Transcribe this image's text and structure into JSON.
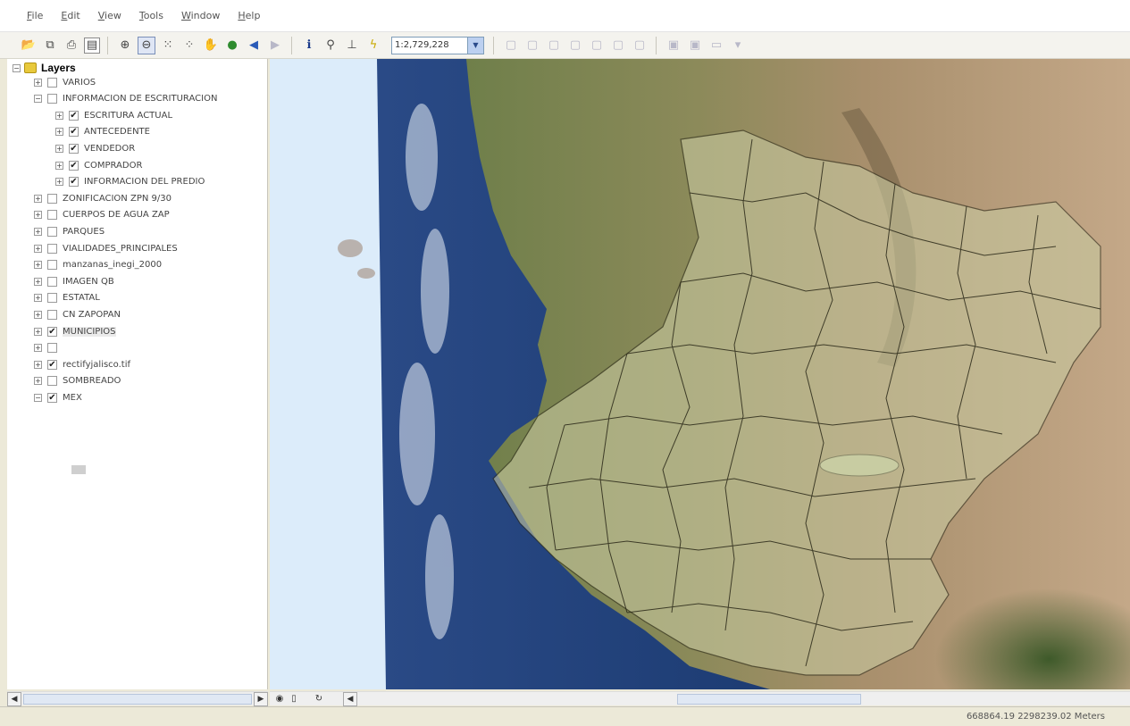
{
  "menu": [
    {
      "label": "File",
      "underline": "F"
    },
    {
      "label": "Edit",
      "underline": "E"
    },
    {
      "label": "View",
      "underline": "V"
    },
    {
      "label": "Tools",
      "underline": "T"
    },
    {
      "label": "Window",
      "underline": "W"
    },
    {
      "label": "Help",
      "underline": "H"
    }
  ],
  "toolbar": {
    "scale_value": "1:2,729,228"
  },
  "toc": {
    "root_label": "Layers",
    "layers": [
      {
        "label": "VARIOS",
        "checked": false,
        "indent": 0,
        "expanded": false
      },
      {
        "label": "INFORMACION DE ESCRITURACION",
        "checked": false,
        "indent": 0,
        "expanded": true
      },
      {
        "label": "ESCRITURA ACTUAL",
        "checked": true,
        "indent": 1,
        "expanded": false
      },
      {
        "label": "ANTECEDENTE",
        "checked": true,
        "indent": 1,
        "expanded": false
      },
      {
        "label": "VENDEDOR",
        "checked": true,
        "indent": 1,
        "expanded": false
      },
      {
        "label": "COMPRADOR",
        "checked": true,
        "indent": 1,
        "expanded": false
      },
      {
        "label": "INFORMACION DEL PREDIO",
        "checked": true,
        "indent": 1,
        "expanded": false
      },
      {
        "label": "ZONIFICACION ZPN 9/30",
        "checked": false,
        "indent": 0,
        "expanded": false
      },
      {
        "label": "CUERPOS DE AGUA ZAP",
        "checked": false,
        "indent": 0,
        "expanded": false
      },
      {
        "label": "PARQUES",
        "checked": false,
        "indent": 0,
        "expanded": false
      },
      {
        "label": "VIALIDADES_PRINCIPALES",
        "checked": false,
        "indent": 0,
        "expanded": false
      },
      {
        "label": "manzanas_inegi_2000",
        "checked": false,
        "indent": 0,
        "expanded": false
      },
      {
        "label": "IMAGEN QB",
        "checked": false,
        "indent": 0,
        "expanded": false
      },
      {
        "label": "ESTATAL",
        "checked": false,
        "indent": 0,
        "expanded": false
      },
      {
        "label": "CN ZAPOPAN",
        "checked": false,
        "indent": 0,
        "expanded": false
      },
      {
        "label": "MUNICIPIOS",
        "checked": true,
        "indent": 0,
        "expanded": false,
        "selected": true
      },
      {
        "label": "",
        "checked": false,
        "indent": 0,
        "expanded": false
      },
      {
        "label": "rectifyjalisco.tif",
        "checked": true,
        "indent": 0,
        "expanded": false
      },
      {
        "label": "SOMBREADO",
        "checked": false,
        "indent": 0,
        "expanded": false
      },
      {
        "label": "MEX",
        "checked": true,
        "indent": 0,
        "expanded": true
      }
    ]
  },
  "status": {
    "coordinates": "668864.19  2298239.02 Meters"
  },
  "colors": {
    "ocean": "#1d3a72",
    "land_green": "#6f7f4a",
    "land_tan": "#b79e78",
    "overlay": "#c8c9a0",
    "boundary": "#2a2818"
  }
}
